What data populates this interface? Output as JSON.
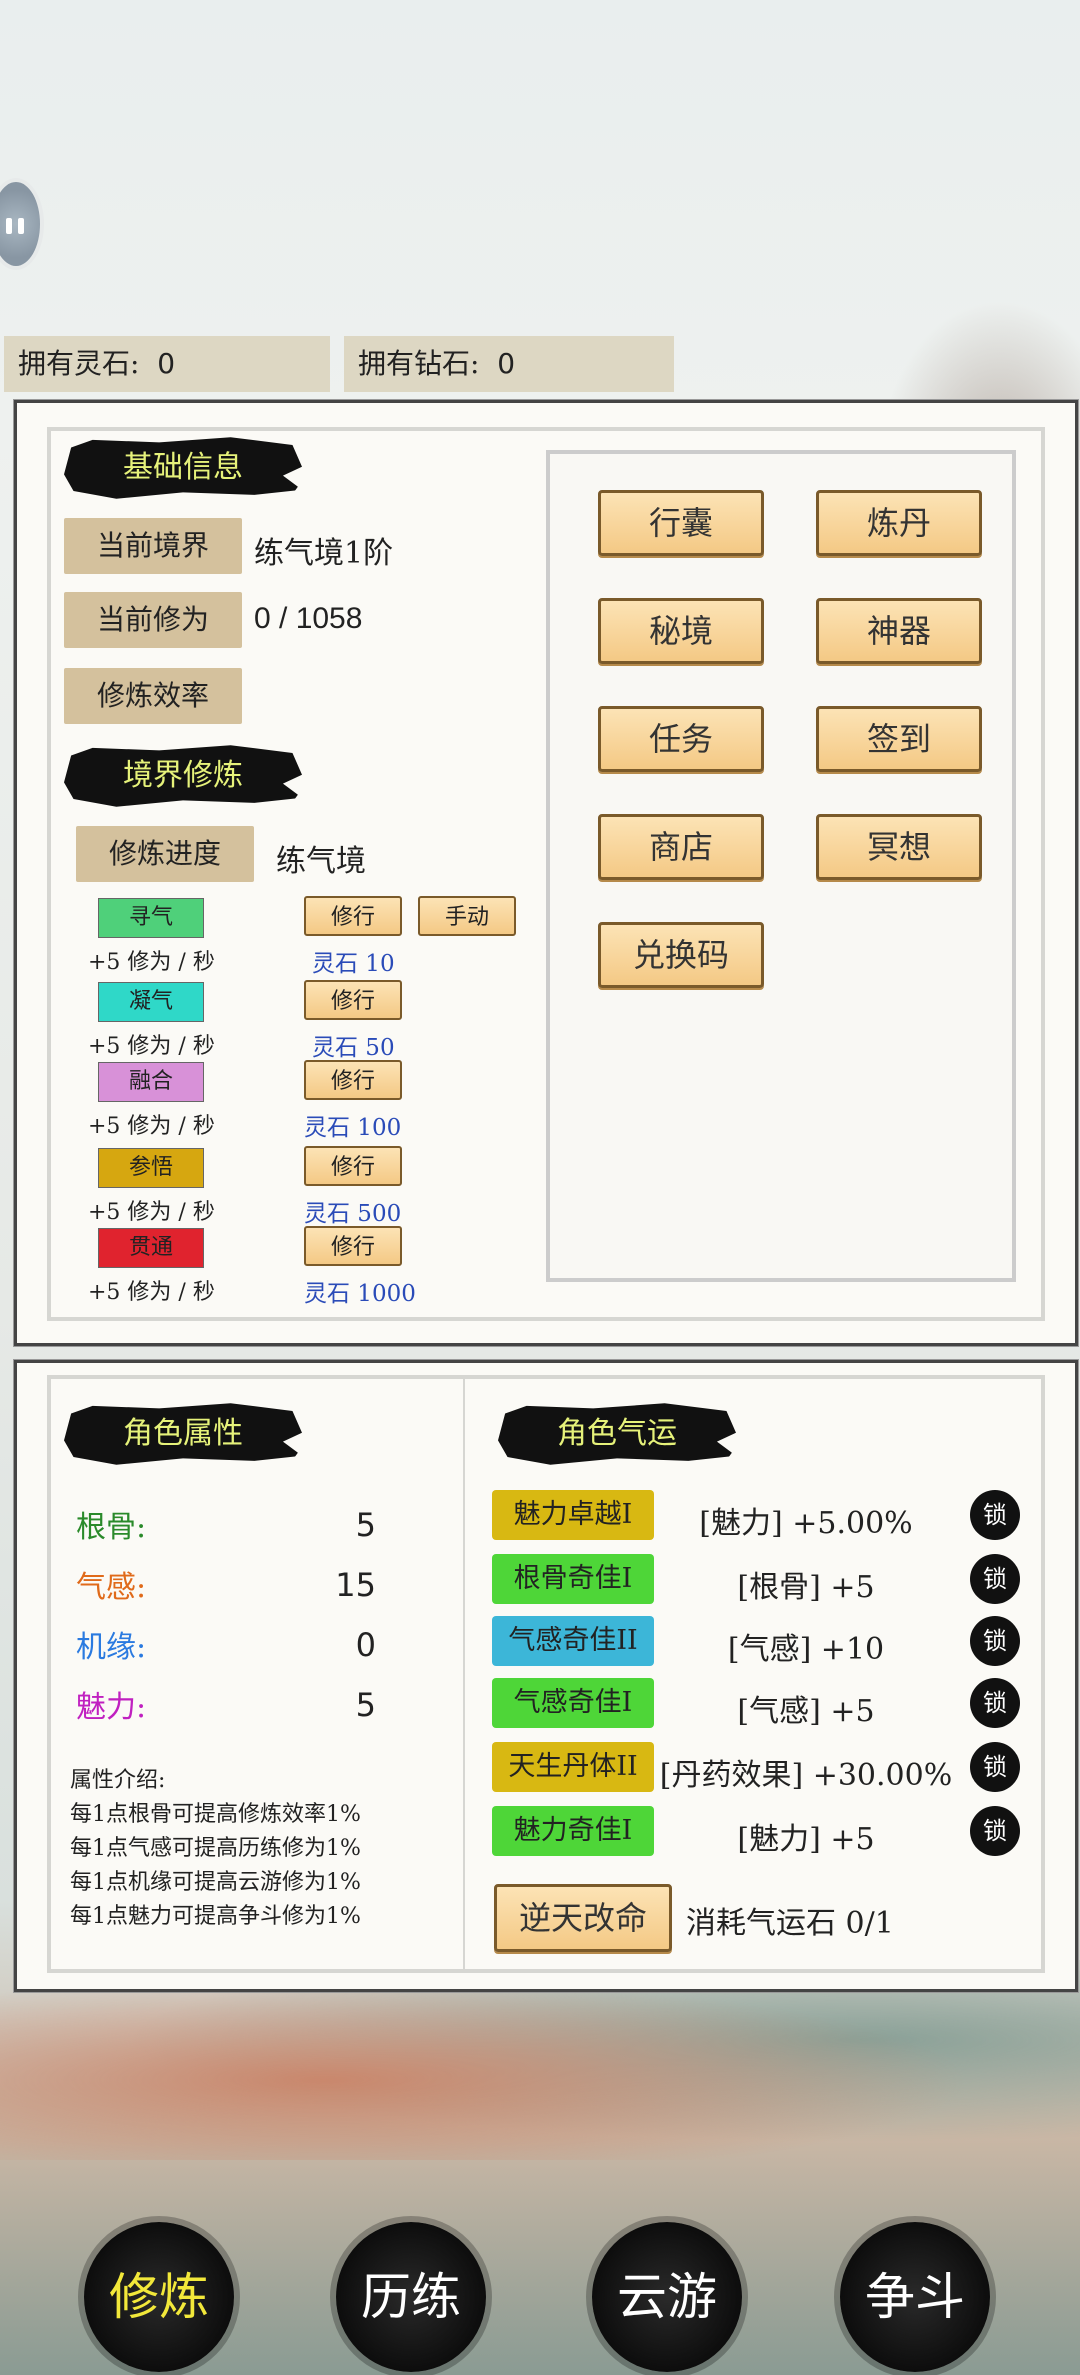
{
  "currency": {
    "stone_label": "拥有灵石:",
    "stone_value": "0",
    "diamond_label": "拥有钻石:",
    "diamond_value": "0"
  },
  "basic": {
    "title": "基础信息",
    "realm_label": "当前境界",
    "realm_value": "练气境1阶",
    "cultivation_label": "当前修为",
    "cultivation_value": "0 / 1058",
    "efficiency_label": "修炼效率"
  },
  "menu": [
    "行囊",
    "炼丹",
    "秘境",
    "神器",
    "任务",
    "签到",
    "商店",
    "冥想",
    "兑换码"
  ],
  "realm": {
    "title": "境界修炼",
    "progress_label": "修炼进度",
    "progress_value": "练气境",
    "rows": [
      {
        "chip": "寻气",
        "chip_color": "#4fd07a",
        "rate": "+5 修为 / 秒",
        "btn": "修行",
        "cost": "灵石 10",
        "extra": "手动"
      },
      {
        "chip": "凝气",
        "chip_color": "#2fd8c8",
        "rate": "+5 修为 / 秒",
        "btn": "修行",
        "cost": "灵石 50"
      },
      {
        "chip": "融合",
        "chip_color": "#d891d8",
        "rate": "+5 修为 / 秒",
        "btn": "修行",
        "cost": "灵石 100"
      },
      {
        "chip": "参悟",
        "chip_color": "#d6a710",
        "rate": "+5 修为 / 秒",
        "btn": "修行",
        "cost": "灵石 500"
      },
      {
        "chip": "贯通",
        "chip_color": "#e0232e",
        "rate": "+5 修为 / 秒",
        "btn": "修行",
        "cost": "灵石 1000"
      }
    ]
  },
  "attributes": {
    "title": "角色属性",
    "items": [
      {
        "label": "根骨:",
        "value": "5",
        "color": "#2a8a2a"
      },
      {
        "label": "气感:",
        "value": "15",
        "color": "#e06a1a"
      },
      {
        "label": "机缘:",
        "value": "0",
        "color": "#2a7ae0"
      },
      {
        "label": "魅力:",
        "value": "5",
        "color": "#c020c0"
      }
    ],
    "intro_title": "属性介绍:",
    "intro": [
      "每1点根骨可提高修炼效率1%",
      "每1点气感可提高历练修为1%",
      "每1点机缘可提高云游修为1%",
      "每1点魅力可提高争斗修为1%"
    ]
  },
  "fortune": {
    "title": "角色气运",
    "items": [
      {
        "name": "魅力卓越I",
        "color": "#d8b812",
        "desc": "[魅力] +5.00%",
        "lock": "锁"
      },
      {
        "name": "根骨奇佳I",
        "color": "#4ed638",
        "desc": "[根骨] +5",
        "lock": "锁"
      },
      {
        "name": "气感奇佳II",
        "color": "#3cb6d8",
        "desc": "[气感] +10",
        "lock": "锁"
      },
      {
        "name": "气感奇佳I",
        "color": "#4ed638",
        "desc": "[气感] +5",
        "lock": "锁"
      },
      {
        "name": "天生丹体II",
        "color": "#d8b812",
        "desc": "[丹药效果] +30.00%",
        "lock": "锁"
      },
      {
        "name": "魅力奇佳I",
        "color": "#4ed638",
        "desc": "[魅力] +5",
        "lock": "锁"
      }
    ],
    "reroll_label": "逆天改命",
    "cost_text": "消耗气运石 0/1"
  },
  "nav": [
    {
      "label": "修炼",
      "color": "#f2e83a"
    },
    {
      "label": "历练",
      "color": "#ffffff"
    },
    {
      "label": "云游",
      "color": "#ffffff"
    },
    {
      "label": "争斗",
      "color": "#ffffff"
    }
  ]
}
